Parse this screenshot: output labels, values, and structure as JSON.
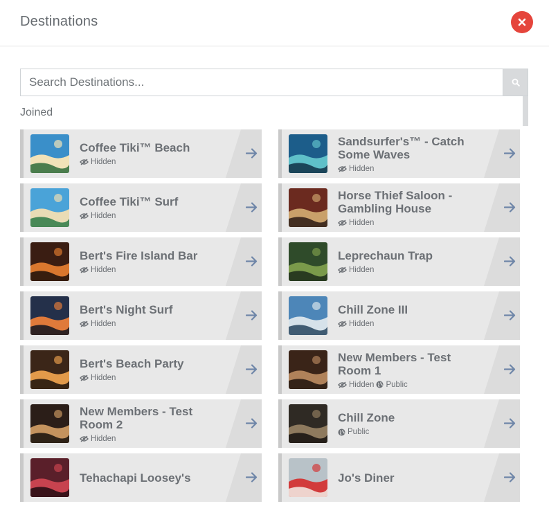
{
  "header": {
    "title": "Destinations",
    "close_icon": "close-icon"
  },
  "search": {
    "placeholder": "Search Destinations...",
    "value": "",
    "icon": "search-icon"
  },
  "section": {
    "label": "Joined"
  },
  "colors": {
    "close": "#e5453c",
    "card_bg": "#e8e8e8",
    "arrow": "#6f86a8"
  },
  "destinations": [
    {
      "name": "Coffee Tiki™ Beach",
      "tags": [
        "Hidden"
      ],
      "thumb": "tiki-beach"
    },
    {
      "name": "Sandsurfer's™ - Catch Some Waves",
      "tags": [
        "Hidden"
      ],
      "thumb": "wave"
    },
    {
      "name": "Coffee Tiki™ Surf",
      "tags": [
        "Hidden"
      ],
      "thumb": "tiki-surf"
    },
    {
      "name": "Horse Thief Saloon - Gambling House",
      "tags": [
        "Hidden"
      ],
      "thumb": "saloon"
    },
    {
      "name": "Bert's Fire Island Bar",
      "tags": [
        "Hidden"
      ],
      "thumb": "fire-island"
    },
    {
      "name": "Leprechaun Trap",
      "tags": [
        "Hidden"
      ],
      "thumb": "leprechaun"
    },
    {
      "name": "Bert's Night Surf",
      "tags": [
        "Hidden"
      ],
      "thumb": "night-surf"
    },
    {
      "name": "Chill Zone III",
      "tags": [
        "Hidden"
      ],
      "thumb": "chill-zone-3"
    },
    {
      "name": "Bert's Beach Party",
      "tags": [
        "Hidden"
      ],
      "thumb": "beach-party"
    },
    {
      "name": "New Members - Test Room 1",
      "tags": [
        "Hidden",
        "Public"
      ],
      "thumb": "test-room-1"
    },
    {
      "name": "New Members - Test Room 2",
      "tags": [
        "Hidden"
      ],
      "thumb": "test-room-2"
    },
    {
      "name": "Chill Zone",
      "tags": [
        "Public"
      ],
      "thumb": "chill-zone"
    },
    {
      "name": "Tehachapi Loosey's",
      "tags": [],
      "thumb": "loosey"
    },
    {
      "name": "Jo's Diner",
      "tags": [],
      "thumb": "diner"
    }
  ]
}
